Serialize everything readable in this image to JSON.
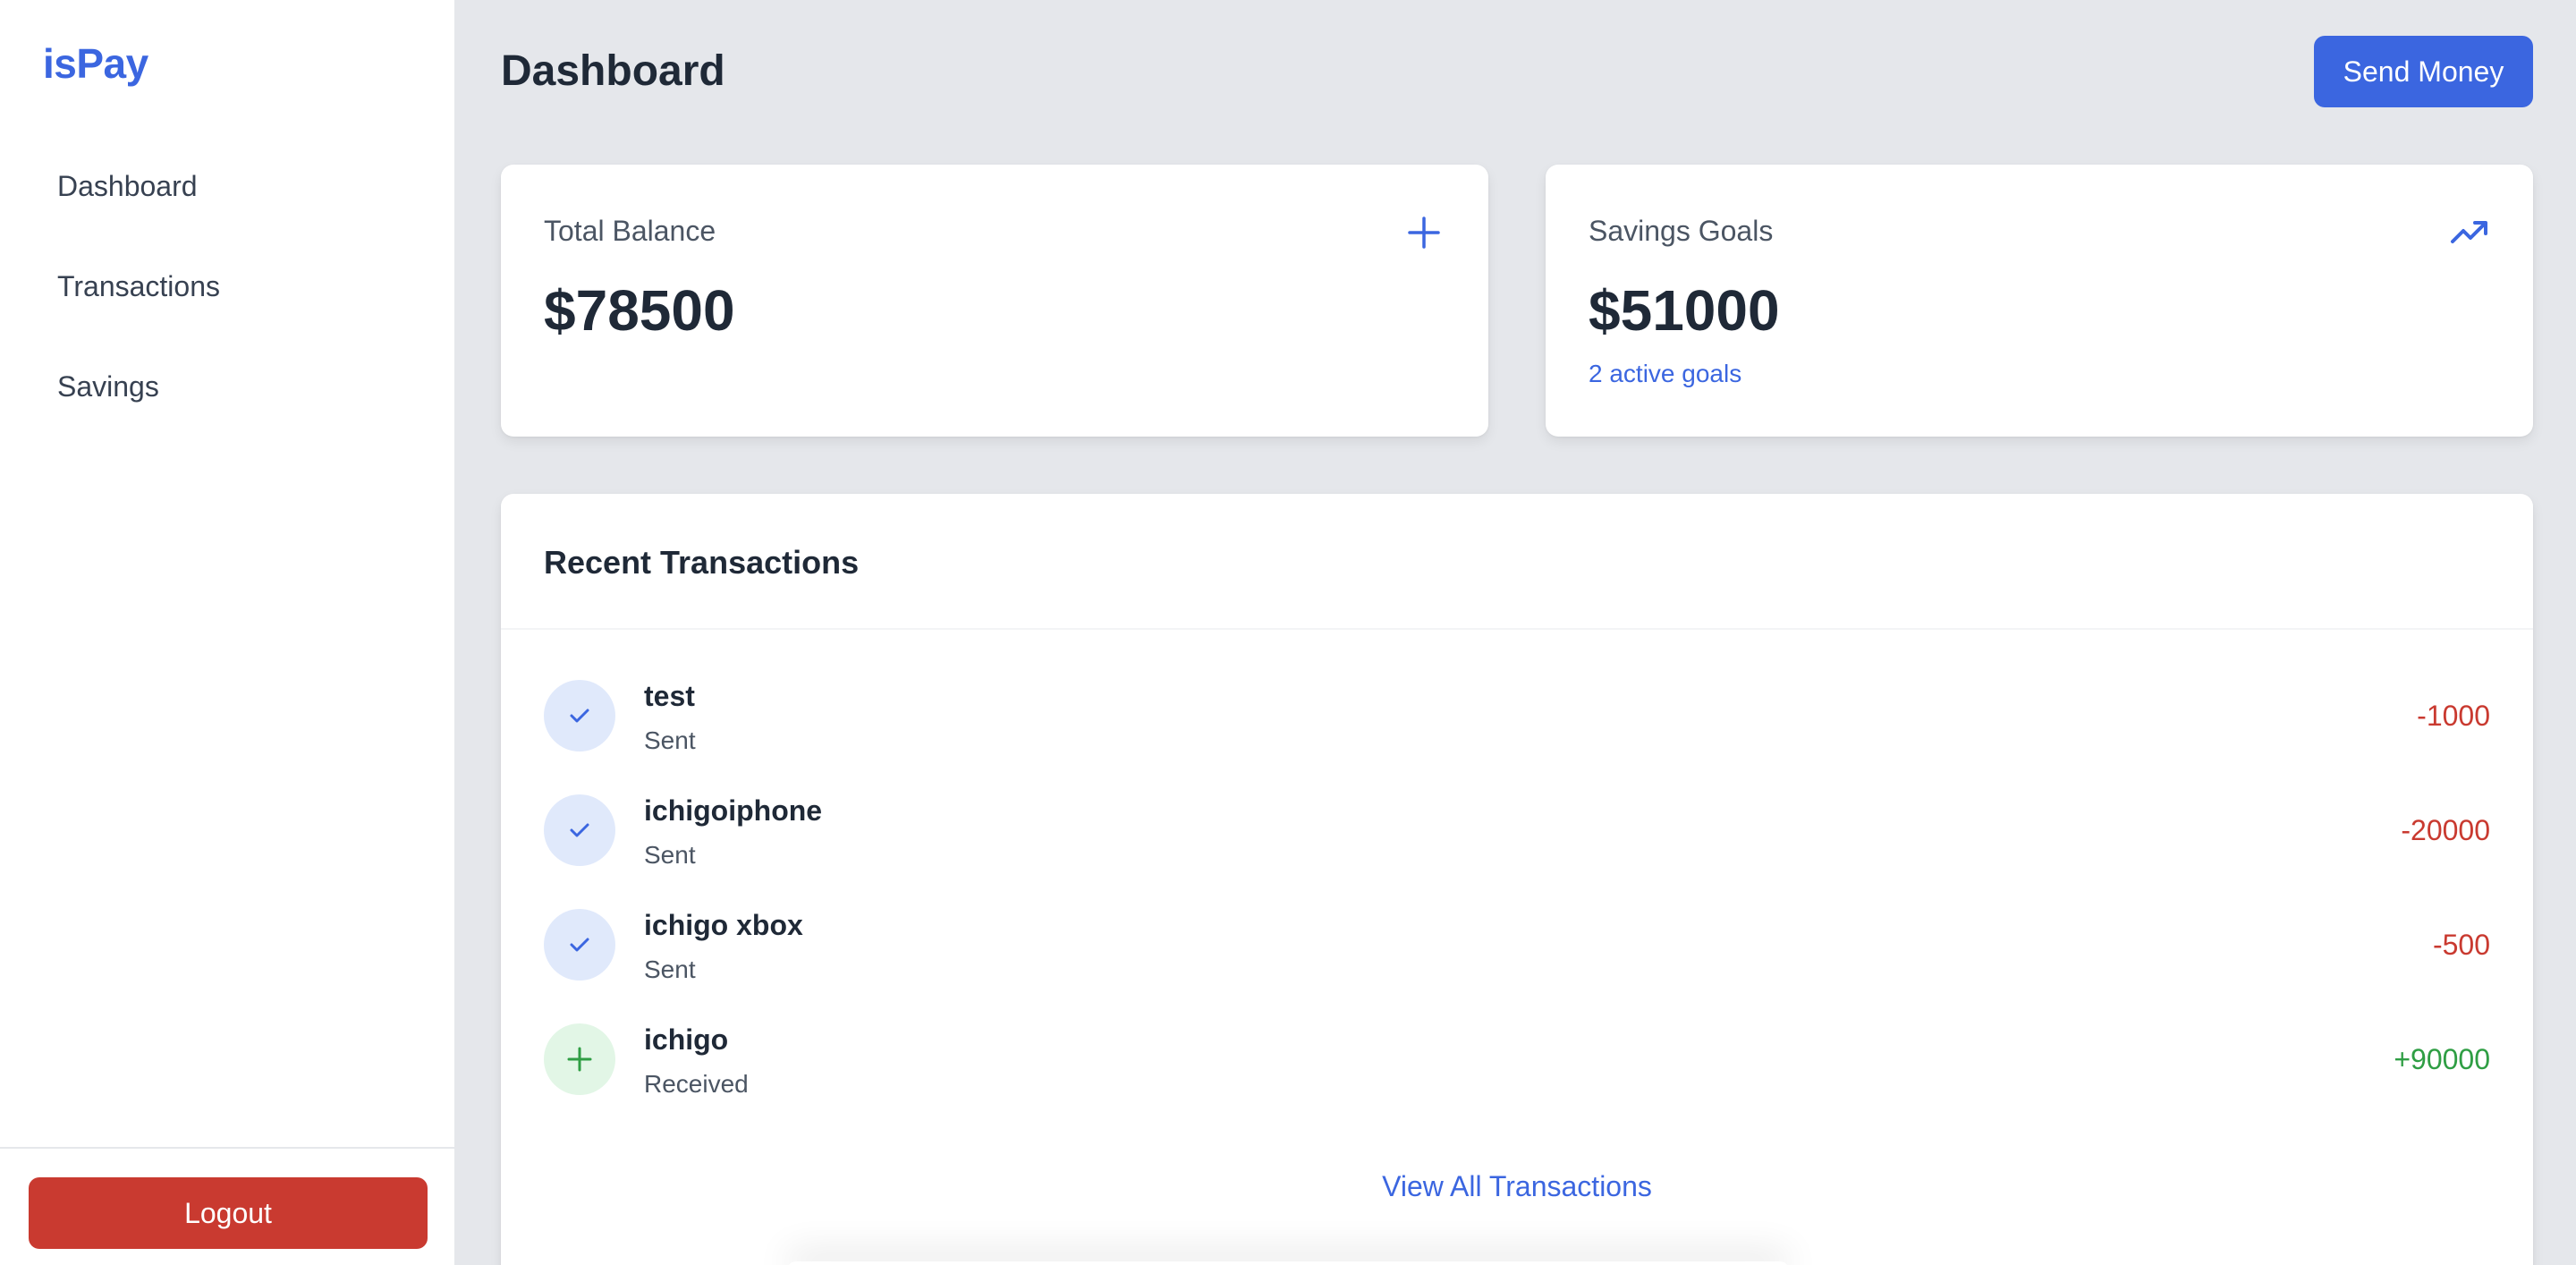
{
  "sidebar": {
    "brand": "isPay",
    "items": [
      {
        "label": "Dashboard"
      },
      {
        "label": "Transactions"
      },
      {
        "label": "Savings"
      }
    ],
    "logout_label": "Logout"
  },
  "header": {
    "title": "Dashboard",
    "send_money_label": "Send Money"
  },
  "balance_card": {
    "label": "Total Balance",
    "value": "$78500",
    "icon": "plus-icon"
  },
  "savings_card": {
    "label": "Savings Goals",
    "value": "$51000",
    "subtext": "2 active goals",
    "icon": "trending-up-icon"
  },
  "transactions": {
    "title": "Recent Transactions",
    "items": [
      {
        "name": "test",
        "type": "Sent",
        "amount": "-1000",
        "icon": "check-icon"
      },
      {
        "name": "ichigoiphone",
        "type": "Sent",
        "amount": "-20000",
        "icon": "check-icon"
      },
      {
        "name": "ichigo xbox",
        "type": "Sent",
        "amount": "-500",
        "icon": "check-icon"
      },
      {
        "name": "ichigo",
        "type": "Received",
        "amount": "+90000",
        "icon": "plus-icon"
      }
    ],
    "view_all_label": "View All Transactions"
  },
  "colors": {
    "accent": "#3b66e0",
    "danger": "#c93a30",
    "success": "#2f9e44",
    "background": "#e5e7eb"
  }
}
